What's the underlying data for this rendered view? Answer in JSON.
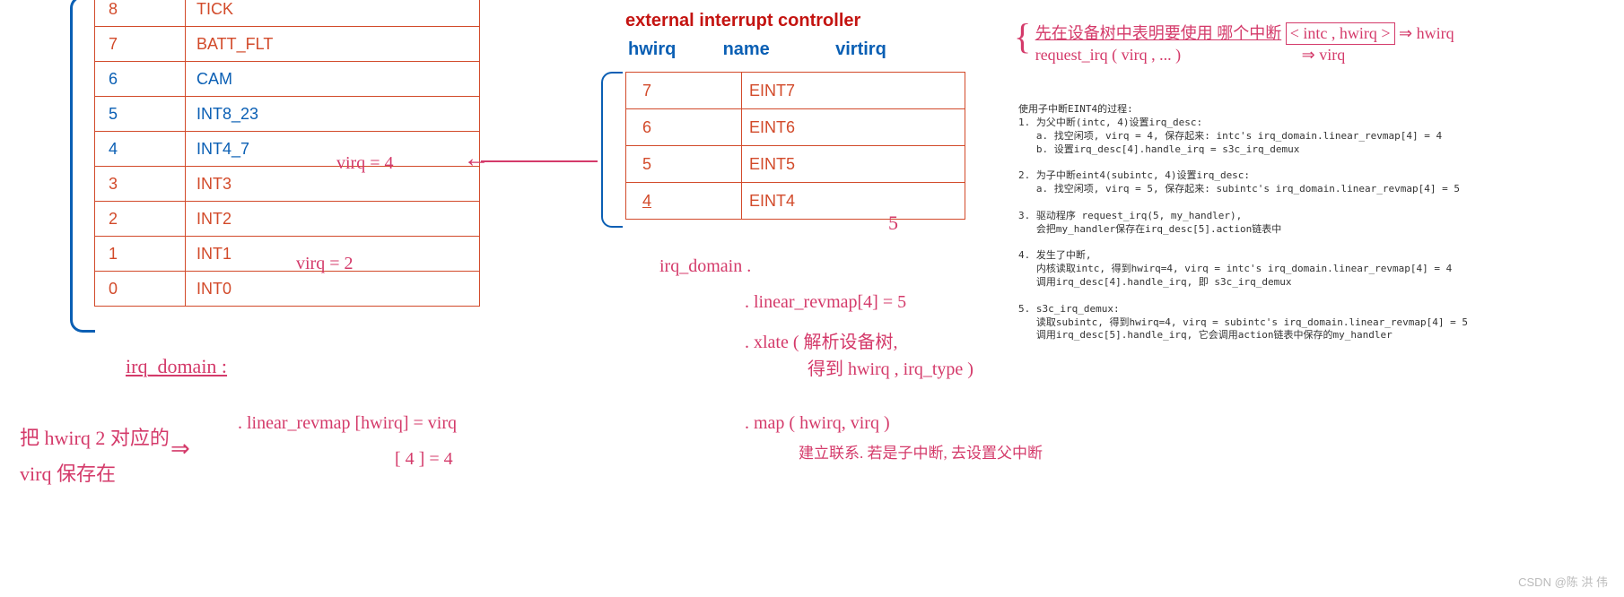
{
  "left_table": {
    "rows": [
      {
        "idx": "8",
        "name": "TICK",
        "blue": false
      },
      {
        "idx": "7",
        "name": "BATT_FLT",
        "blue": false
      },
      {
        "idx": "6",
        "name": "CAM",
        "blue": true
      },
      {
        "idx": "5",
        "name": "INT8_23",
        "blue": true
      },
      {
        "idx": "4",
        "name": "INT4_7",
        "blue": true
      },
      {
        "idx": "3",
        "name": "INT3",
        "blue": false
      },
      {
        "idx": "2",
        "name": "INT2",
        "blue": false
      },
      {
        "idx": "1",
        "name": "INT1",
        "blue": false
      },
      {
        "idx": "0",
        "name": "INT0",
        "blue": false
      }
    ]
  },
  "ext_title": "external interrupt controller",
  "ext_headers": {
    "h1": "hwirq",
    "h2": "name",
    "h3": "virtirq"
  },
  "ext_table": {
    "rows": [
      {
        "idx": "7",
        "name": "EINT7"
      },
      {
        "idx": "6",
        "name": "EINT6"
      },
      {
        "idx": "5",
        "name": "EINT5"
      },
      {
        "idx": "4",
        "name": "EINT4"
      }
    ]
  },
  "hand_left": {
    "virq4": "virq = 4",
    "virq2": "virq = 2",
    "irq_domain": "irq_domain :",
    "line1": "把 hwirq 2 对应的",
    "line2": "virq 保存在",
    "rhs1": ". linear_revmap [hwirq] = virq",
    "rhs2": "[ 4 ] = 4"
  },
  "hand_mid": {
    "five": "5",
    "l1": "irq_domain .",
    "l2": ". linear_revmap[4] = 5",
    "l3": ". xlate  ( 解析设备树,",
    "l4": "得到 hwirq , irq_type )",
    "l5": ". map  (  hwirq,  virq    )",
    "l6": "建立联系.  若是子中断, 去设置父中断"
  },
  "hw_top_right": {
    "open": "{",
    "l1": "先在设备树中表明要使用 哪个中断",
    "l2": "request_irq ( virq , ... )",
    "box": "< intc , hwirq >",
    "to_hwirq": "⇒ hwirq",
    "to_virq": "⇒ virq"
  },
  "notes_text": "使用子中断EINT4的过程:\n1. 为父中断(intc, 4)设置irq_desc:\n   a. 找空闲项, virq = 4, 保存起来: intc's irq_domain.linear_revmap[4] = 4\n   b. 设置irq_desc[4].handle_irq = s3c_irq_demux\n\n2. 为子中断eint4(subintc, 4)设置irq_desc:\n   a. 找空闲项, virq = 5, 保存起来: subintc's irq_domain.linear_revmap[4] = 5\n\n3. 驱动程序 request_irq(5, my_handler),\n   会把my_handler保存在irq_desc[5].action链表中\n\n4. 发生了中断,\n   内核读取intc, 得到hwirq=4, virq = intc's irq_domain.linear_revmap[4] = 4\n   调用irq_desc[4].handle_irq, 即 s3c_irq_demux\n\n5. s3c_irq_demux:\n   读取subintc, 得到hwirq=4, virq = subintc's irq_domain.linear_revmap[4] = 5\n   调用irq_desc[5].handle_irq, 它会调用action链表中保存的my_handler",
  "watermark": "CSDN @陈 洪 伟"
}
